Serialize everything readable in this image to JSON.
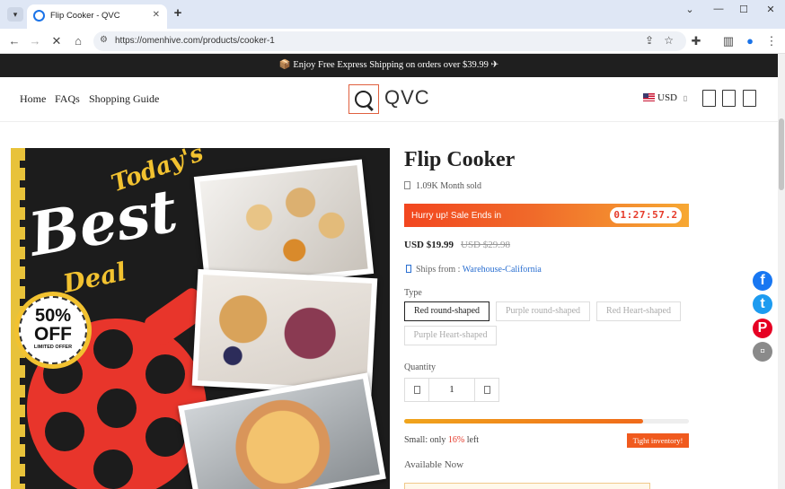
{
  "browser": {
    "tab_title": "Flip Cooker - QVC",
    "url": "https://omenhive.com/products/cooker-1"
  },
  "announcement": "📦 Enjoy Free Express Shipping on orders over $39.99 ✈",
  "header": {
    "menu": [
      "Home",
      "FAQs",
      "Shopping Guide"
    ],
    "logo_text": "QVC",
    "currency": "USD"
  },
  "product_image": {
    "headline_1": "Today's",
    "headline_2": "Best",
    "headline_3": "Deal",
    "badge_line_1": "50%",
    "badge_line_2": "OFF",
    "badge_line_3": "LIMITED OFFER"
  },
  "product": {
    "title": "Flip Cooker",
    "sold": "1.09K Month sold",
    "sale_text": "Hurry up! Sale Ends in",
    "countdown": "01:27:57.2",
    "price": "USD $19.99",
    "old_price": "USD $29.98",
    "ships_label": "Ships from :",
    "ships_from": "Warehouse-California",
    "type_label": "Type",
    "variants": [
      "Red round-shaped",
      "Purple round-shaped",
      "Red Heart-shaped",
      "Purple Heart-shaped"
    ],
    "selected_variant": "Red round-shaped",
    "quantity_label": "Quantity",
    "quantity": "1",
    "stock_prefix": "Small: only ",
    "stock_pct_text": "16%",
    "stock_suffix": " left",
    "stock_fill": 0.84,
    "tight_label": "Tight inventory!",
    "available_label": "Available Now"
  },
  "colors": {
    "accent": "#f05a1e",
    "link": "#2a6fd1",
    "logo_border": "#e0603f",
    "facebook": "#1877f2",
    "twitter": "#1d9bf0",
    "pinterest": "#e60023"
  },
  "social": [
    {
      "name": "facebook-icon",
      "glyph": "f"
    },
    {
      "name": "twitter-icon",
      "glyph": "t"
    },
    {
      "name": "pinterest-icon",
      "glyph": "P"
    },
    {
      "name": "share-icon",
      "glyph": "▫"
    }
  ]
}
